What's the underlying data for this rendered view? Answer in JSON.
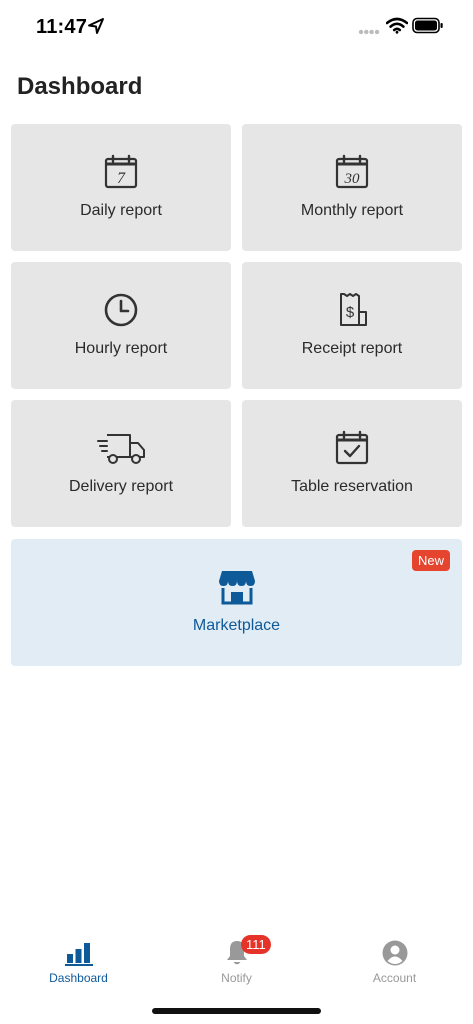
{
  "status": {
    "time": "11:47"
  },
  "page": {
    "title": "Dashboard"
  },
  "cards": [
    {
      "label": "Daily report",
      "icon": "calendar-7-icon",
      "day": "7"
    },
    {
      "label": "Monthly report",
      "icon": "calendar-30-icon",
      "day": "30"
    },
    {
      "label": "Hourly report",
      "icon": "clock-icon"
    },
    {
      "label": "Receipt report",
      "icon": "receipt-dollar-icon",
      "symbol": "$"
    },
    {
      "label": "Delivery report",
      "icon": "delivery-truck-icon"
    },
    {
      "label": "Table reservation",
      "icon": "calendar-check-icon"
    }
  ],
  "marketplace": {
    "label": "Marketplace",
    "badge": "New",
    "icon": "store-icon"
  },
  "tabs": [
    {
      "label": "Dashboard",
      "icon": "bar-chart-icon",
      "active": true
    },
    {
      "label": "Notify",
      "icon": "bell-icon",
      "badge": "111"
    },
    {
      "label": "Account",
      "icon": "user-circle-icon"
    }
  ],
  "colors": {
    "accent": "#0e5a99",
    "card_bg": "#e6e6e6",
    "market_bg": "#e1ecf5",
    "badge": "#e5452f"
  }
}
